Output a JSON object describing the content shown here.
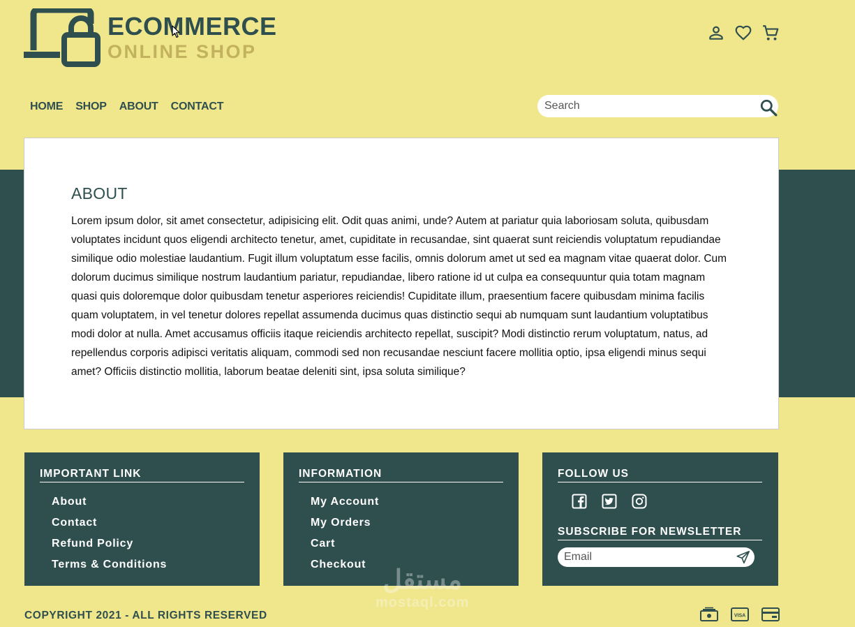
{
  "brand": {
    "title": "ECOMMERCE",
    "subtitle": "ONLINE SHOP"
  },
  "header_icons": [
    "user-icon",
    "heart-icon",
    "cart-icon"
  ],
  "nav": {
    "items": [
      "HOME",
      "SHOP",
      "ABOUT",
      "CONTACT"
    ]
  },
  "search": {
    "placeholder": "Search"
  },
  "about": {
    "title": "ABOUT",
    "body": "Lorem ipsum dolor, sit amet consectetur, adipisicing elit. Odit quas animi, unde? Autem at pariatur quia laboriosam soluta, quibusdam voluptates incidunt quos eligendi architecto tenetur, amet, cupiditate in recusandae, sint quaerat sunt reiciendis voluptatum repudiandae similique odio molestiae laudantium. Fugit illum voluptatum esse facilis, omnis dolorum amet ut sed ea magnam vitae quaerat dolor. Cum dolorum ducimus similique nostrum laudantium pariatur, repudiandae, libero ratione id ut culpa ea consequuntur quia totam magnam quasi quis doloremque dolor quibusdam tenetur asperiores reiciendis! Cupiditate illum, praesentium facere quibusdam minima facilis quam voluptatem, in vel tenetur dolores repellat assumenda ducimus quas distinctio sequi ab numquam sunt laudantium voluptatibus modi dolor at nulla. Amet accusamus officiis itaque reiciendis architecto repellat, suscipit? Modi distinctio rerum voluptatum, natus, ad repellendus corporis adipisci veritatis aliquam, commodi sed non recusandae nesciunt facere mollitia optio, ipsa eligendi minus sequi amet? Officiis distinctio mollitia, laborum beatae deleniti sint, ipsa soluta similique?"
  },
  "footer": {
    "important": {
      "title": "IMPORTANT LINK",
      "links": [
        "About",
        "Contact",
        "Refund Policy",
        "Terms & Conditions"
      ]
    },
    "information": {
      "title": "INFORMATION",
      "links": [
        "My Account",
        "My Orders",
        "Cart",
        "Checkout"
      ]
    },
    "follow": {
      "title": "FOLLOW US",
      "social_icons": [
        "facebook-icon",
        "twitter-icon",
        "instagram-icon"
      ],
      "newsletter_title": "SUBSCRIBE FOR NEWSLETTER",
      "email_placeholder": "Email"
    },
    "copyright": "COPYRIGHT 2021 - ALL RIGHTS RESERVED",
    "payment_icons": [
      "cash-icon",
      "visa-icon",
      "card-icon"
    ]
  },
  "watermark": {
    "arabic": "مستقل",
    "latin": "mostaql.com"
  },
  "colors": {
    "background": "#f0e68c",
    "primary": "#2f4f4f",
    "accent": "#c2b25e",
    "card": "#ffffff"
  }
}
